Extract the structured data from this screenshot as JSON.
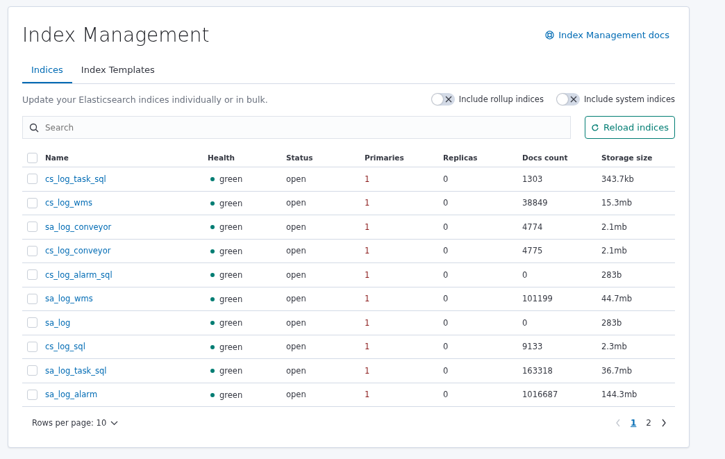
{
  "header": {
    "title": "Index Management",
    "docs_link": "Index Management docs"
  },
  "tabs": [
    {
      "label": "Indices",
      "selected": true
    },
    {
      "label": "Index Templates",
      "selected": false
    }
  ],
  "description": "Update your Elasticsearch indices individually or in bulk.",
  "toggles": [
    {
      "label": "Include rollup indices",
      "on": false
    },
    {
      "label": "Include system indices",
      "on": false
    }
  ],
  "search": {
    "placeholder": "Search"
  },
  "reload_button": "Reload indices",
  "table": {
    "select_all_checked": false,
    "columns": [
      "Name",
      "Health",
      "Status",
      "Primaries",
      "Replicas",
      "Docs count",
      "Storage size"
    ],
    "rows": [
      {
        "checked": false,
        "name": "cs_log_task_sql",
        "health": "green",
        "color": "#017d73",
        "status": "open",
        "primaries": "1",
        "replicas": "0",
        "docs_count": "1303",
        "storage_size": "343.7kb"
      },
      {
        "checked": false,
        "name": "cs_log_wms",
        "health": "green",
        "color": "#017d73",
        "status": "open",
        "primaries": "1",
        "replicas": "0",
        "docs_count": "38849",
        "storage_size": "15.3mb"
      },
      {
        "checked": false,
        "name": "sa_log_conveyor",
        "health": "green",
        "color": "#017d73",
        "status": "open",
        "primaries": "1",
        "replicas": "0",
        "docs_count": "4774",
        "storage_size": "2.1mb"
      },
      {
        "checked": false,
        "name": "cs_log_conveyor",
        "health": "green",
        "color": "#017d73",
        "status": "open",
        "primaries": "1",
        "replicas": "0",
        "docs_count": "4775",
        "storage_size": "2.1mb"
      },
      {
        "checked": false,
        "name": "cs_log_alarm_sql",
        "health": "green",
        "color": "#017d73",
        "status": "open",
        "primaries": "1",
        "replicas": "0",
        "docs_count": "0",
        "storage_size": "283b"
      },
      {
        "checked": false,
        "name": "sa_log_wms",
        "health": "green",
        "color": "#017d73",
        "status": "open",
        "primaries": "1",
        "replicas": "0",
        "docs_count": "101199",
        "storage_size": "44.7mb"
      },
      {
        "checked": false,
        "name": "sa_log",
        "health": "green",
        "color": "#017d73",
        "status": "open",
        "primaries": "1",
        "replicas": "0",
        "docs_count": "0",
        "storage_size": "283b"
      },
      {
        "checked": false,
        "name": "cs_log_sql",
        "health": "green",
        "color": "#017d73",
        "status": "open",
        "primaries": "1",
        "replicas": "0",
        "docs_count": "9133",
        "storage_size": "2.3mb"
      },
      {
        "checked": false,
        "name": "sa_log_task_sql",
        "health": "green",
        "color": "#017d73",
        "status": "open",
        "primaries": "1",
        "replicas": "0",
        "docs_count": "163318",
        "storage_size": "36.7mb"
      },
      {
        "checked": false,
        "name": "sa_log_alarm",
        "health": "green",
        "color": "#017d73",
        "status": "open",
        "primaries": "1",
        "replicas": "0",
        "docs_count": "1016687",
        "storage_size": "144.3mb"
      }
    ]
  },
  "footer": {
    "rows_per_page": "Rows per page: 10",
    "prev_disabled": true,
    "next_disabled": false,
    "pages": [
      {
        "label": "1",
        "selected": true
      },
      {
        "label": "2",
        "selected": false
      }
    ]
  }
}
